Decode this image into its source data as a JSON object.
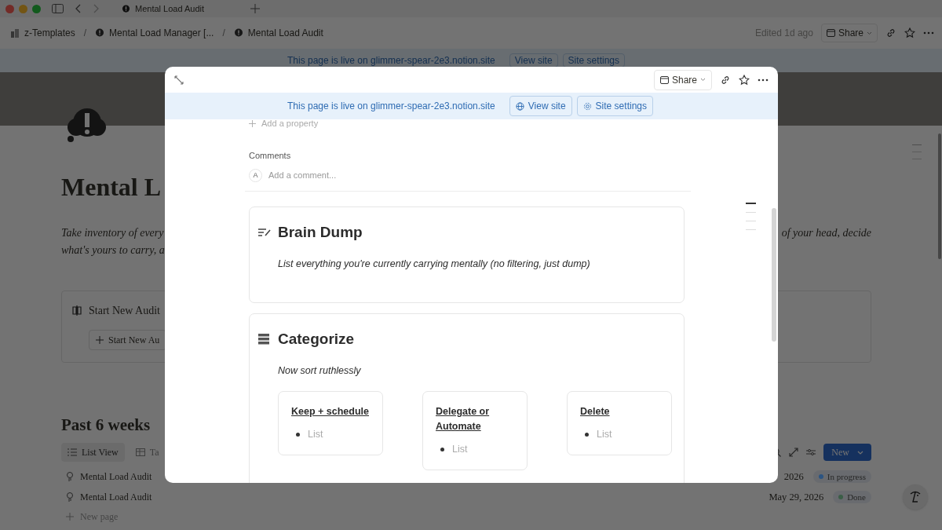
{
  "browser": {
    "tab_title": "Mental Load Audit"
  },
  "topbar": {
    "separator": "/",
    "breadcrumbs": [
      "z-Templates",
      "Mental Load Manager [...",
      "Mental Load Audit"
    ],
    "edited": "Edited 1d ago",
    "share": "Share"
  },
  "live_banner": {
    "text": "This page is live on glimmer-spear-2e3.notion.site",
    "view_site": "View site",
    "site_settings": "Site settings"
  },
  "page": {
    "title": "Mental L",
    "description_left": [
      "Take inventory of every",
      "what's yours to carry, a"
    ],
    "description_right": "of your head, decide",
    "callout": {
      "title": "Start New Audit",
      "button": "Start New Au"
    },
    "section_heading": "Past 6 weeks",
    "views": [
      {
        "label": "List View",
        "selected": true
      },
      {
        "label": "Ta",
        "selected": false
      }
    ],
    "new_button": "New",
    "rows": [
      {
        "title": "Mental Load Audit",
        "date": "2026",
        "status": "In progress",
        "color": "#2c5482"
      },
      {
        "title": "Mental Load Audit",
        "date": "May 29, 2026",
        "status": "Done",
        "color": "#3b5e47"
      }
    ],
    "new_page": "New page"
  },
  "modal": {
    "share": "Share",
    "banner": {
      "text": "This page is live on glimmer-spear-2e3.notion.site",
      "view_site": "View site",
      "site_settings": "Site settings"
    },
    "add_property": "Add a property",
    "comments_label": "Comments",
    "avatar": "A",
    "comment_placeholder": "Add a comment...",
    "blocks": [
      {
        "kind": "note",
        "title": "Brain Dump",
        "subtitle": "List everything you're currently carrying mentally (no filtering, just dump)"
      },
      {
        "kind": "columns",
        "title": "Categorize",
        "subtitle": "Now sort ruthlessly",
        "columns": [
          {
            "heading": "Keep + schedule",
            "items": [
              {
                "placeholder": "List"
              }
            ]
          },
          {
            "heading": "Delegate or Automate",
            "items": [
              {
                "placeholder": "List"
              }
            ]
          },
          {
            "heading": "Delete",
            "items": [
              {
                "placeholder": "List"
              }
            ]
          }
        ]
      }
    ]
  }
}
